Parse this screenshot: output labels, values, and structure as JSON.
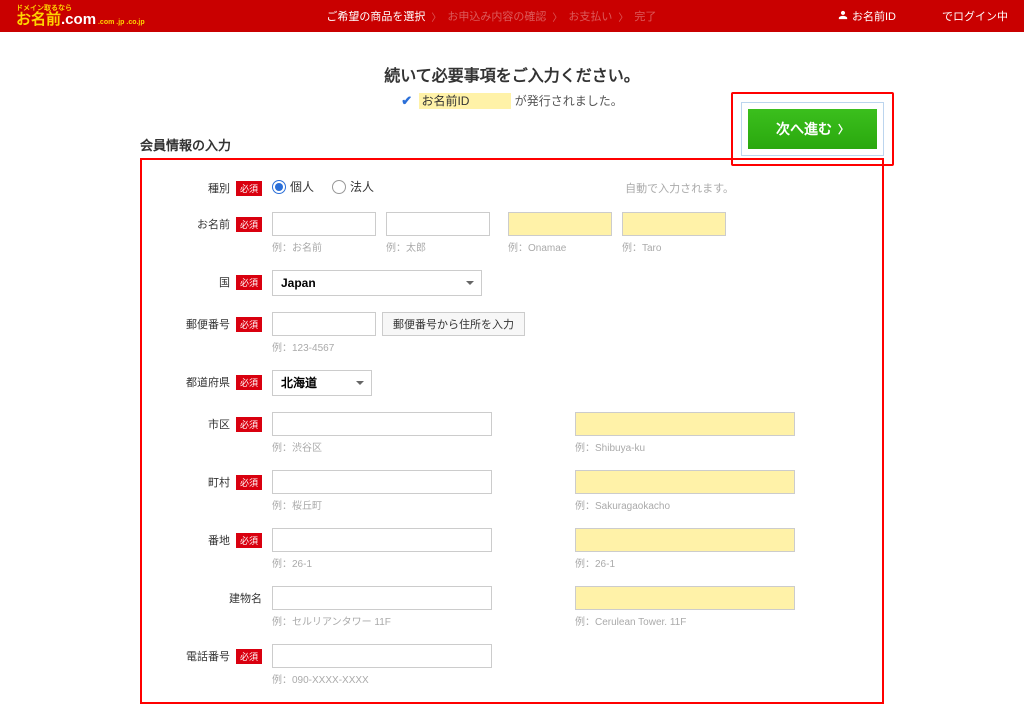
{
  "header": {
    "logo_small": "ドメイン取るなら",
    "logo_main_1": "お名前",
    "logo_main_2": ".com",
    "steps": [
      "ご希望の商品を選択",
      "お申込み内容の確認",
      "お支払い",
      "完了"
    ],
    "login_prefix": "お名前ID",
    "login_suffix": "でログイン中"
  },
  "main": {
    "title": "続いて必要事項をご入力ください。",
    "issued_prefix": "お名前ID",
    "issued_suffix": "が発行されました。",
    "next_btn": "次へ進む",
    "section_title": "会員情報の入力",
    "auto_note": "自動で入力されます。"
  },
  "labels": {
    "type": "種別",
    "name": "お名前",
    "country": "国",
    "postal": "郵便番号",
    "pref": "都道府県",
    "city": "市区",
    "town": "町村",
    "street": "番地",
    "building": "建物名",
    "phone": "電話番号",
    "required": "必須"
  },
  "type": {
    "individual": "個人",
    "corporate": "法人"
  },
  "name": {
    "ex1": "例：お名前",
    "ex2": "例：太郎",
    "ex3": "例：Onamae",
    "ex4": "例：Taro"
  },
  "country": {
    "value": "Japan"
  },
  "postal": {
    "button": "郵便番号から住所を入力",
    "ex": "例：123-4567"
  },
  "pref": {
    "value": "北海道"
  },
  "city": {
    "ex": "例：渋谷区",
    "ex_en": "例：Shibuya-ku"
  },
  "town": {
    "ex": "例：桜丘町",
    "ex_en": "例：Sakuragaokacho"
  },
  "street": {
    "ex": "例：26-1",
    "ex_en": "例：26-1"
  },
  "building": {
    "ex": "例：セルリアンタワー 11F",
    "ex_en": "例：Cerulean Tower. 11F"
  },
  "phone": {
    "ex": "例：090-XXXX-XXXX"
  }
}
